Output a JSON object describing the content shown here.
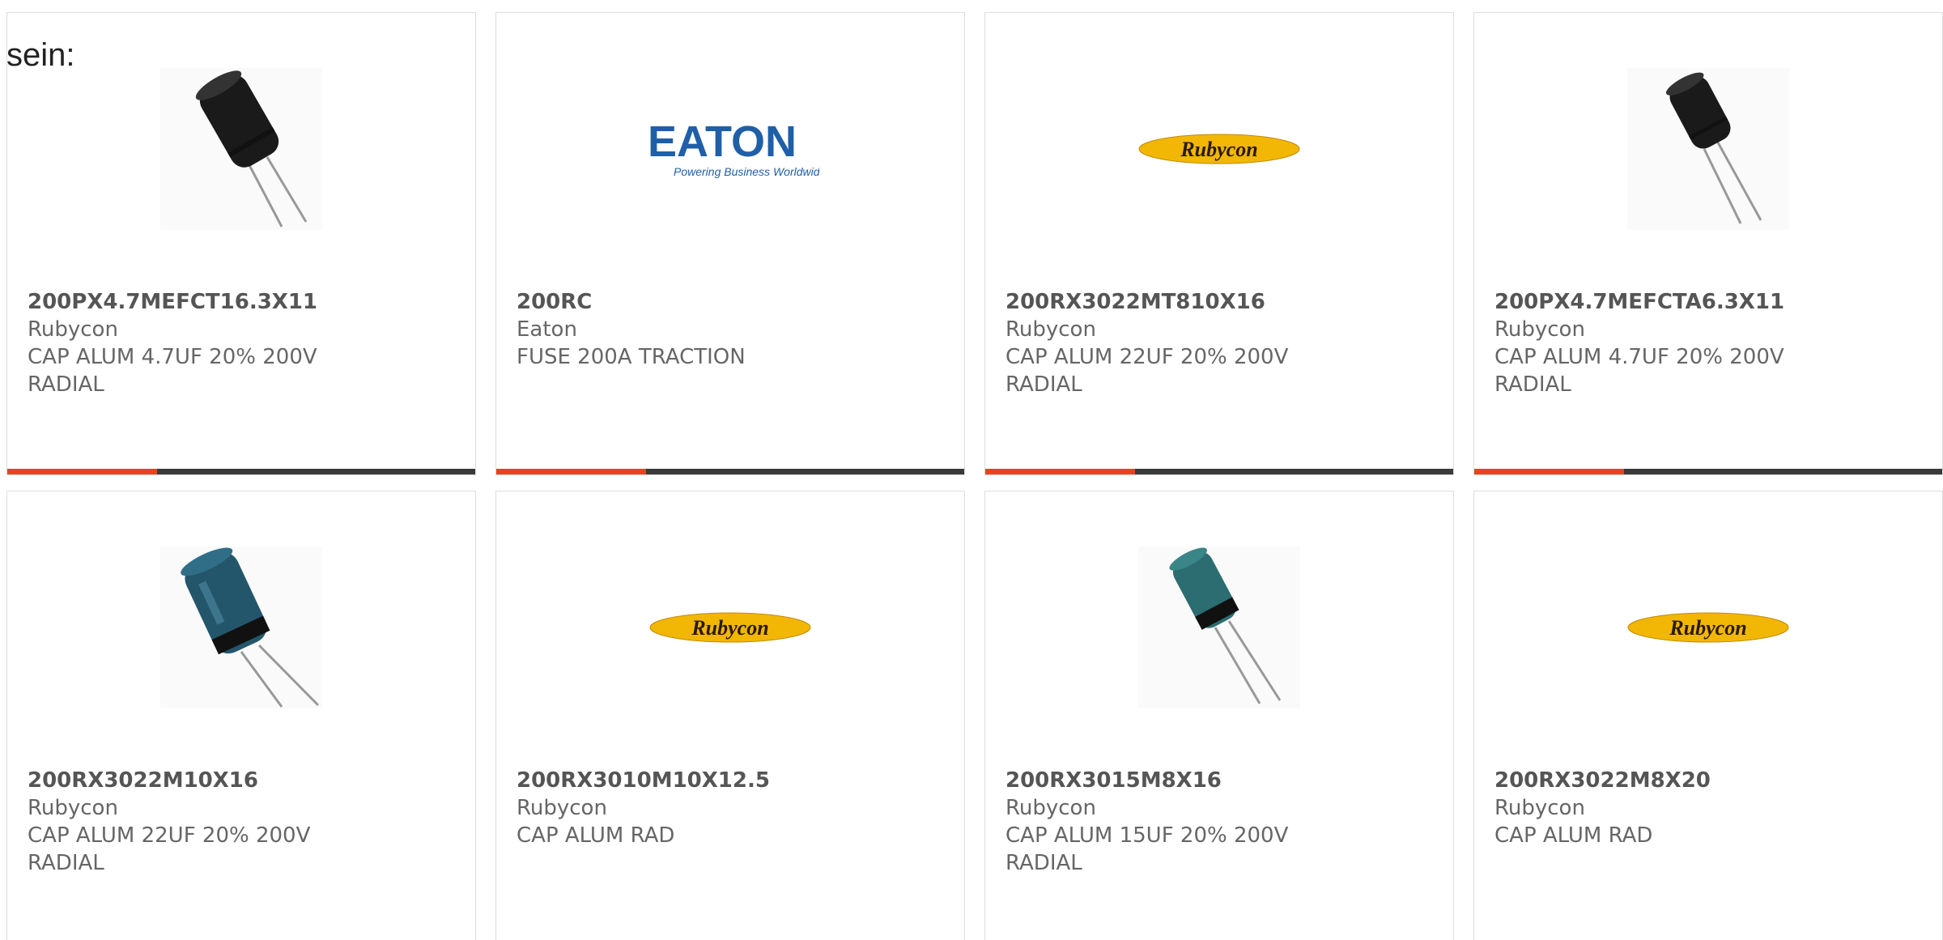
{
  "heading_fragment": "sein:",
  "products": [
    {
      "part_number": "200PX4.7MEFCT16.3X11",
      "manufacturer": "Rubycon",
      "description": "CAP ALUM 4.7UF 20% 200V RADIAL",
      "image": "capacitor-black-icon",
      "progress": 0.32
    },
    {
      "part_number": "200RC",
      "manufacturer": "Eaton",
      "description": "FUSE 200A TRACTION",
      "image": "eaton-logo",
      "logo_text": "EATON",
      "logo_tagline": "Powering Business Worldwide",
      "progress": 0.32
    },
    {
      "part_number": "200RX3022MT810X16",
      "manufacturer": "Rubycon",
      "description": "CAP ALUM 22UF 20% 200V RADIAL",
      "image": "rubycon-logo",
      "logo_text": "Rubycon",
      "progress": 0.32
    },
    {
      "part_number": "200PX4.7MEFCTA6.3X11",
      "manufacturer": "Rubycon",
      "description": "CAP ALUM 4.7UF 20% 200V RADIAL",
      "image": "capacitor-black-small-icon",
      "progress": 0.32
    },
    {
      "part_number": "200RX3022M10X16",
      "manufacturer": "Rubycon",
      "description": "CAP ALUM 22UF 20% 200V RADIAL",
      "image": "capacitor-blue-icon"
    },
    {
      "part_number": "200RX3010M10X12.5",
      "manufacturer": "Rubycon",
      "description": "CAP ALUM RAD",
      "image": "rubycon-logo",
      "logo_text": "Rubycon"
    },
    {
      "part_number": "200RX3015M8X16",
      "manufacturer": "Rubycon",
      "description": "CAP ALUM 15UF 20% 200V RADIAL",
      "image": "capacitor-teal-icon"
    },
    {
      "part_number": "200RX3022M8X20",
      "manufacturer": "Rubycon",
      "description": "CAP ALUM RAD",
      "image": "rubycon-logo",
      "logo_text": "Rubycon"
    }
  ],
  "colors": {
    "accent": "#e8431e",
    "bar_dark": "#3a3a3a",
    "rubycon_yellow": "#f2b705",
    "eaton_blue": "#1f5fa8"
  }
}
